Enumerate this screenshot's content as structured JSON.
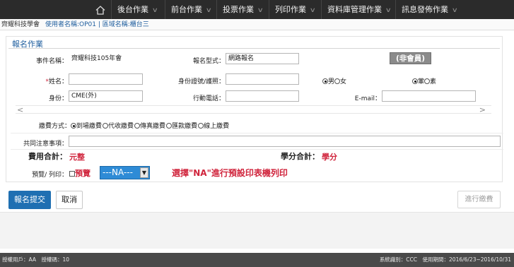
{
  "nav": {
    "home_icon": "home-icon",
    "items": [
      {
        "label": "後台作業"
      },
      {
        "label": "前台作業"
      },
      {
        "label": "投票作業"
      },
      {
        "label": "列印作業"
      },
      {
        "label": "資料庫管理作業"
      },
      {
        "label": "訊息發佈作業"
      }
    ]
  },
  "infobar": {
    "org": "齊耀科技學會",
    "user": "使用者名稱:OP01 | 區域名稱:櫃台三"
  },
  "form": {
    "title": "報名作業",
    "event_label": "事件名稱：",
    "event_value": "齊耀科技105年會",
    "regtype_label": "報名型式：",
    "regtype_value": "網路報名",
    "member_badge": "(非會員)",
    "name_label_req": "*",
    "name_label": "姓名：",
    "name_value": "",
    "id_label": "身份證號/護照：",
    "id_value": "",
    "gender_male": "男",
    "gender_female": "女",
    "diet_meat": "葷",
    "diet_veg": "素",
    "identity_label": "身份：",
    "identity_value": "CME(外)",
    "mobile_label": "行動電話：",
    "mobile_value": "",
    "email_label": "E-mail：",
    "email_value": "",
    "scroll_left": "<",
    "scroll_right": ">",
    "pay_label": "繳費方式：",
    "pay_options": [
      "到場繳費",
      "代收繳費",
      "傳真繳費",
      "匯款繳費",
      "線上繳費"
    ],
    "notes_label": "共同注意事項：",
    "notes_value": "",
    "fee_total_label": "費用合計：",
    "fee_total_value": "元整",
    "credit_total_label": "學分合計：",
    "credit_total_value": "學分",
    "preview_label": "預覽/ 列印：",
    "preview_check_label": "預覽",
    "printer_selected": "---NA---",
    "printer_hint": "選擇\"NA\"進行預設印表機列印"
  },
  "buttons": {
    "submit": "報名提交",
    "cancel": "取消",
    "pay": "進行繳費"
  },
  "footer": {
    "left": "授權用戶：AA　授權碼：10",
    "right": "系統識別：CCC　使用期間：2016/6/23~2016/10/31"
  },
  "colors": {
    "accent": "#1f6fb2",
    "danger": "#d0243c",
    "topbar": "#2b2b2b"
  }
}
